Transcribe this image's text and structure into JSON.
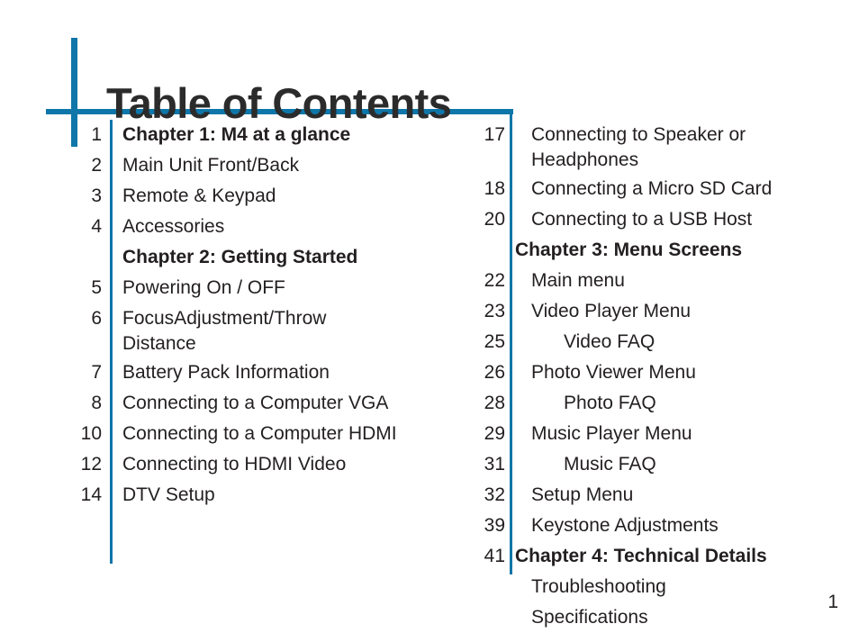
{
  "document": {
    "title": "Table of Contents",
    "folio": "1",
    "accent_color": "#0e76a8",
    "text_color": "#231f20"
  },
  "columns": {
    "left": [
      {
        "page": "1",
        "label": "Chapter 1: M4 at a glance",
        "kind": "chapter"
      },
      {
        "page": "2",
        "label": "Main Unit Front/Back",
        "kind": "entry"
      },
      {
        "page": "3",
        "label": "Remote & Keypad",
        "kind": "entry"
      },
      {
        "page": "4",
        "label": "Accessories",
        "kind": "entry"
      },
      {
        "page": "",
        "label": "Chapter 2: Getting Started",
        "kind": "chapter"
      },
      {
        "page": "5",
        "label": "Powering On / OFF",
        "kind": "entry"
      },
      {
        "page": "6",
        "label": "FocusAdjustment/Throw",
        "kind": "entry"
      },
      {
        "page": "",
        "label": "Distance",
        "kind": "continuation"
      },
      {
        "page": "7",
        "label": "Battery Pack Information",
        "kind": "entry"
      },
      {
        "page": "8",
        "label": "Connecting to a Computer VGA",
        "kind": "entry"
      },
      {
        "page": "10",
        "label": "Connecting to a Computer HDMI",
        "kind": "entry"
      },
      {
        "page": "12",
        "label": "Connecting to HDMI Video",
        "kind": "entry"
      },
      {
        "page": "14",
        "label": "DTV Setup",
        "kind": "entry"
      }
    ],
    "right": [
      {
        "page": "17",
        "label": "Connecting to Speaker or",
        "kind": "entry"
      },
      {
        "page": "",
        "label": "Headphones",
        "kind": "continuation"
      },
      {
        "page": "18",
        "label": "Connecting a Micro SD Card",
        "kind": "entry"
      },
      {
        "page": "20",
        "label": "Connecting to a USB Host",
        "kind": "entry"
      },
      {
        "page": "",
        "label": "Chapter 3: Menu Screens",
        "kind": "chapter"
      },
      {
        "page": "22",
        "label": "Main menu",
        "kind": "entry"
      },
      {
        "page": "23",
        "label": "Video Player Menu",
        "kind": "entry"
      },
      {
        "page": "25",
        "label": "Video FAQ",
        "kind": "sub"
      },
      {
        "page": "26",
        "label": "Photo Viewer Menu",
        "kind": "entry"
      },
      {
        "page": "28",
        "label": "Photo FAQ",
        "kind": "sub"
      },
      {
        "page": "29",
        "label": "Music Player Menu",
        "kind": "entry"
      },
      {
        "page": "31",
        "label": "Music FAQ",
        "kind": "sub"
      },
      {
        "page": "32",
        "label": "Setup Menu",
        "kind": "entry"
      },
      {
        "page": "39",
        "label": "Keystone Adjustments",
        "kind": "entry"
      },
      {
        "page": "41",
        "label": "Chapter 4: Technical Details",
        "kind": "chapter"
      },
      {
        "page": "",
        "label": "Troubleshooting",
        "kind": "entry"
      },
      {
        "page": "",
        "label": "Specifications",
        "kind": "entry"
      }
    ]
  }
}
